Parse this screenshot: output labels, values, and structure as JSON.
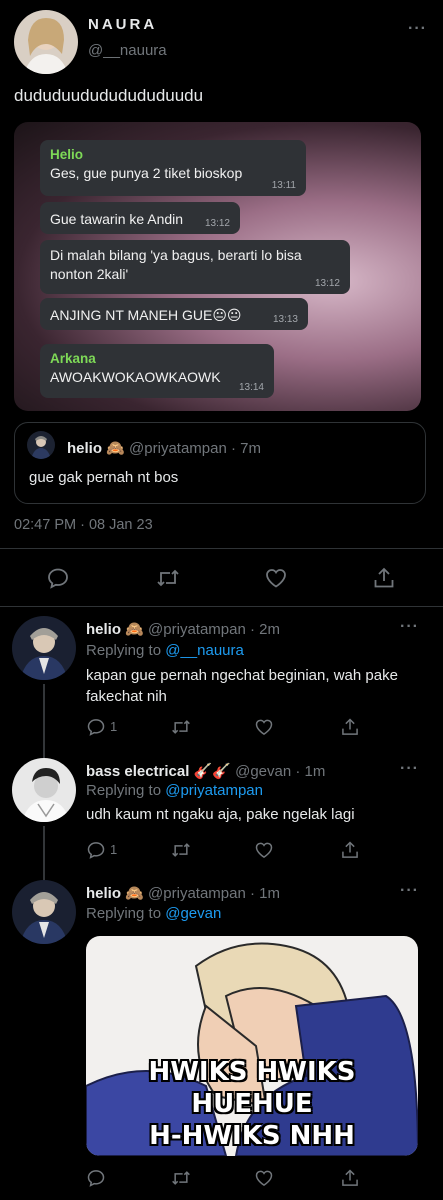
{
  "main_tweet": {
    "display_name": "NAURA",
    "handle": "@__nauura",
    "text": "dududuudududududuudu",
    "chat": {
      "messages": [
        {
          "sender": "Helio",
          "text": "Ges, gue punya 2 tiket bioskop",
          "time": "13:11"
        },
        {
          "sender": "",
          "text": "Gue tawarin ke Andin",
          "time": "13:12"
        },
        {
          "sender": "",
          "text": "Di malah bilang 'ya bagus, berarti lo bisa nonton 2kali'",
          "time": "13:12"
        },
        {
          "sender": "",
          "text": "ANJING NT MANEH GUE😐😐",
          "time": "13:13"
        },
        {
          "sender": "Arkana",
          "text": "AWOAKWOKAOWKAOWK",
          "time": "13:14"
        }
      ]
    },
    "quote": {
      "name": "helio",
      "emoji": "🙈",
      "handle": "@priyatampan",
      "time": "· 7m",
      "text": "gue gak pernah nt bos"
    },
    "timestamp": "02:47 PM · 08 Jan 23"
  },
  "replies": [
    {
      "name": "helio",
      "emoji": "🙈",
      "handle": "@priyatampan",
      "time": "· 2m",
      "replying_label": "Replying to",
      "replying_to": "@__nauura",
      "text": "kapan gue pernah ngechat beginian, wah pake fakechat nih",
      "reply_count": "1"
    },
    {
      "name": "bass electrical",
      "emoji": "🎸🎸",
      "handle": "@gevan",
      "time": "· 1m",
      "replying_label": "Replying to",
      "replying_to": "@priyatampan",
      "text": "udh kaum nt ngaku aja, pake ngelak lagi",
      "reply_count": "1"
    },
    {
      "name": "helio",
      "emoji": "🙈",
      "handle": "@priyatampan",
      "time": "· 1m",
      "replying_label": "Replying to",
      "replying_to": "@gevan",
      "meme_text": [
        "HWIKS HWIKS",
        "HUEHUE",
        "H-HWIKS NHH"
      ]
    }
  ],
  "icons": {
    "reply": "comment-icon",
    "retweet": "retweet-icon",
    "like": "heart-icon",
    "share": "share-icon",
    "more": "more-icon"
  },
  "colors": {
    "background": "#000000",
    "link": "#1d9bf0",
    "muted": "#71767b",
    "chat_sender": "#7ed957"
  }
}
